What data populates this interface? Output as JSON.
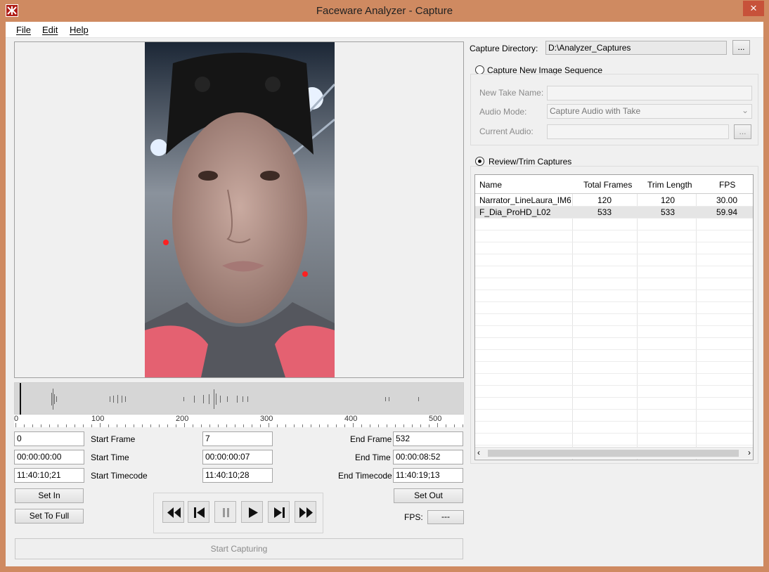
{
  "window": {
    "title": "Faceware Analyzer - Capture",
    "close": "×"
  },
  "menu": {
    "items": [
      "File",
      "Edit",
      "Help"
    ]
  },
  "ruler": {
    "labels": [
      "0",
      "100",
      "200",
      "300",
      "400",
      "500"
    ]
  },
  "timing": {
    "start_frame_value": "0",
    "start_frame_label": "Start Frame",
    "start_time_value": "00:00:00:00",
    "start_time_label": "Start Time",
    "start_timecode_value": "11:40:10;21",
    "start_timecode_label": "Start Timecode",
    "current_frame_value": "7",
    "current_time_value": "00:00:00:07",
    "current_timecode_value": "11:40:10;28",
    "end_frame_label": "End Frame",
    "end_frame_value": "532",
    "end_time_label": "End Time",
    "end_time_value": "00:00:08:52",
    "end_timecode_label": "End Timecode",
    "end_timecode_value": "11:40:19;13"
  },
  "buttons": {
    "set_in": "Set In",
    "set_to_full": "Set To Full",
    "set_out": "Set Out",
    "start_capturing": "Start Capturing",
    "fps_label": "FPS:",
    "fps_value": "---"
  },
  "capture_directory": {
    "label": "Capture Directory:",
    "value": "D:\\Analyzer_Captures",
    "browse": "..."
  },
  "new_sequence": {
    "radio_label": "Capture New Image Sequence",
    "take_name_label": "New Take Name:",
    "audio_mode_label": "Audio Mode:",
    "audio_mode_value": "Capture Audio with Take",
    "current_audio_label": "Current Audio:",
    "browse": "..."
  },
  "review": {
    "radio_label": "Review/Trim Captures",
    "columns": [
      "Name",
      "Total Frames",
      "Trim Length",
      "FPS"
    ],
    "rows": [
      [
        "Narrator_LineLaura_IM6....",
        "120",
        "120",
        "30.00"
      ],
      [
        "F_Dia_ProHD_L02",
        "533",
        "533",
        "59.94"
      ]
    ]
  }
}
